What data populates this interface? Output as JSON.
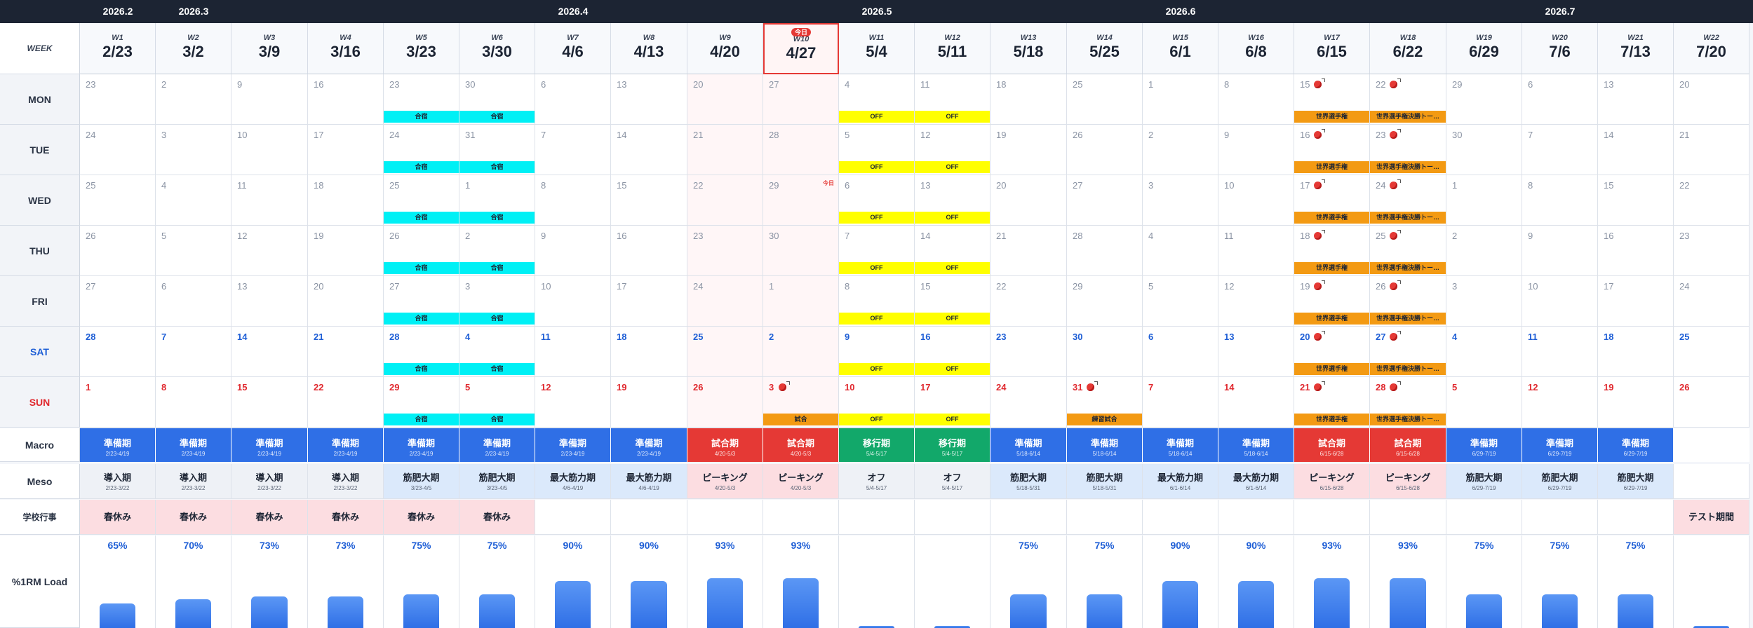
{
  "header": {
    "week_label": "WEEK"
  },
  "months": [
    {
      "label": "2026.2",
      "col": 0
    },
    {
      "label": "2026.3",
      "col": 1
    },
    {
      "label": "2026.4",
      "col": 6
    },
    {
      "label": "2026.5",
      "col": 10
    },
    {
      "label": "2026.6",
      "col": 14
    },
    {
      "label": "2026.7",
      "col": 19
    }
  ],
  "today_badge": "今日",
  "today_col": 9,
  "weeks": [
    {
      "w": "W1",
      "date": "2/23",
      "days": [
        "23",
        "24",
        "25",
        "26",
        "27",
        "28",
        "1"
      ]
    },
    {
      "w": "W2",
      "date": "3/2",
      "days": [
        "2",
        "3",
        "4",
        "5",
        "6",
        "7",
        "8"
      ]
    },
    {
      "w": "W3",
      "date": "3/9",
      "days": [
        "9",
        "10",
        "11",
        "12",
        "13",
        "14",
        "15"
      ]
    },
    {
      "w": "W4",
      "date": "3/16",
      "days": [
        "16",
        "17",
        "18",
        "19",
        "20",
        "21",
        "22"
      ]
    },
    {
      "w": "W5",
      "date": "3/23",
      "days": [
        "23",
        "24",
        "25",
        "26",
        "27",
        "28",
        "29"
      ]
    },
    {
      "w": "W6",
      "date": "3/30",
      "days": [
        "30",
        "31",
        "1",
        "2",
        "3",
        "4",
        "5"
      ]
    },
    {
      "w": "W7",
      "date": "4/6",
      "days": [
        "6",
        "7",
        "8",
        "9",
        "10",
        "11",
        "12"
      ]
    },
    {
      "w": "W8",
      "date": "4/13",
      "days": [
        "13",
        "14",
        "15",
        "16",
        "17",
        "18",
        "19"
      ]
    },
    {
      "w": "W9",
      "date": "4/20",
      "days": [
        "20",
        "21",
        "22",
        "23",
        "24",
        "25",
        "26"
      ]
    },
    {
      "w": "W10",
      "date": "4/27",
      "days": [
        "27",
        "28",
        "29",
        "30",
        "1",
        "2",
        "3"
      ]
    },
    {
      "w": "W11",
      "date": "5/4",
      "days": [
        "4",
        "5",
        "6",
        "7",
        "8",
        "9",
        "10"
      ]
    },
    {
      "w": "W12",
      "date": "5/11",
      "days": [
        "11",
        "12",
        "13",
        "14",
        "15",
        "16",
        "17"
      ]
    },
    {
      "w": "W13",
      "date": "5/18",
      "days": [
        "18",
        "19",
        "20",
        "21",
        "22",
        "23",
        "24"
      ]
    },
    {
      "w": "W14",
      "date": "5/25",
      "days": [
        "25",
        "26",
        "27",
        "28",
        "29",
        "30",
        "31"
      ]
    },
    {
      "w": "W15",
      "date": "6/1",
      "days": [
        "1",
        "2",
        "3",
        "4",
        "5",
        "6",
        "7"
      ]
    },
    {
      "w": "W16",
      "date": "6/8",
      "days": [
        "8",
        "9",
        "10",
        "11",
        "12",
        "13",
        "14"
      ]
    },
    {
      "w": "W17",
      "date": "6/15",
      "days": [
        "15",
        "16",
        "17",
        "18",
        "19",
        "20",
        "21"
      ]
    },
    {
      "w": "W18",
      "date": "6/22",
      "days": [
        "22",
        "23",
        "24",
        "25",
        "26",
        "27",
        "28"
      ]
    },
    {
      "w": "W19",
      "date": "6/29",
      "days": [
        "29",
        "30",
        "1",
        "2",
        "3",
        "4",
        "5"
      ]
    },
    {
      "w": "W20",
      "date": "7/6",
      "days": [
        "6",
        "7",
        "8",
        "9",
        "10",
        "11",
        "12"
      ]
    },
    {
      "w": "W21",
      "date": "7/13",
      "days": [
        "13",
        "14",
        "15",
        "16",
        "17",
        "18",
        "19"
      ]
    },
    {
      "w": "W22",
      "date": "7/20",
      "days": [
        "20",
        "21",
        "22",
        "23",
        "24",
        "25",
        "26"
      ]
    }
  ],
  "day_labels": [
    "MON",
    "TUE",
    "WED",
    "THU",
    "FRI",
    "SAT",
    "SUN"
  ],
  "row_labels": {
    "macro": "Macro",
    "meso": "Meso",
    "school": "学校行事",
    "load": "%1RM Load"
  },
  "pink_cols": [
    8,
    9
  ],
  "events": [
    {
      "col": 4,
      "rows": [
        0,
        1,
        2,
        3,
        4,
        5,
        6
      ],
      "label": "合宿",
      "color": "cyan"
    },
    {
      "col": 5,
      "rows": [
        0,
        1,
        2,
        3,
        4,
        5,
        6
      ],
      "label": "合宿",
      "color": "cyan"
    },
    {
      "col": 10,
      "rows": [
        0,
        1,
        2,
        3,
        4,
        5,
        6
      ],
      "label": "OFF",
      "color": "yellow"
    },
    {
      "col": 11,
      "rows": [
        0,
        1,
        2,
        3,
        4,
        5,
        6
      ],
      "label": "OFF",
      "color": "yellow"
    },
    {
      "col": 9,
      "rows": [
        6
      ],
      "label": "試合",
      "color": "orange"
    },
    {
      "col": 13,
      "rows": [
        6
      ],
      "label": "練習試合",
      "color": "orange"
    },
    {
      "col": 16,
      "rows": [
        0,
        1,
        2,
        3,
        4,
        5,
        6
      ],
      "label": "世界選手権",
      "color": "orange"
    },
    {
      "col": 17,
      "rows": [
        0,
        1,
        2,
        3,
        4,
        5,
        6
      ],
      "label": "世界選手権決勝トー…",
      "color": "orange"
    }
  ],
  "ball_cells": [
    {
      "col": 9,
      "row": 6
    },
    {
      "col": 13,
      "row": 6
    },
    {
      "col": 16,
      "row": 0
    },
    {
      "col": 16,
      "row": 1
    },
    {
      "col": 16,
      "row": 2
    },
    {
      "col": 16,
      "row": 3
    },
    {
      "col": 16,
      "row": 4
    },
    {
      "col": 16,
      "row": 5
    },
    {
      "col": 16,
      "row": 6
    },
    {
      "col": 17,
      "row": 0
    },
    {
      "col": 17,
      "row": 1
    },
    {
      "col": 17,
      "row": 2
    },
    {
      "col": 17,
      "row": 3
    },
    {
      "col": 17,
      "row": 4
    },
    {
      "col": 17,
      "row": 5
    },
    {
      "col": 17,
      "row": 6
    }
  ],
  "side_badge": {
    "col": 9,
    "row": 2,
    "text": "今日"
  },
  "macro": [
    {
      "name": "準備期",
      "range": "2/23-4/19",
      "color": "#2f6fe6"
    },
    {
      "name": "準備期",
      "range": "2/23-4/19",
      "color": "#2f6fe6"
    },
    {
      "name": "準備期",
      "range": "2/23-4/19",
      "color": "#2f6fe6"
    },
    {
      "name": "準備期",
      "range": "2/23-4/19",
      "color": "#2f6fe6"
    },
    {
      "name": "準備期",
      "range": "2/23-4/19",
      "color": "#2f6fe6"
    },
    {
      "name": "準備期",
      "range": "2/23-4/19",
      "color": "#2f6fe6"
    },
    {
      "name": "準備期",
      "range": "2/23-4/19",
      "color": "#2f6fe6"
    },
    {
      "name": "準備期",
      "range": "2/23-4/19",
      "color": "#2f6fe6"
    },
    {
      "name": "試合期",
      "range": "4/20-5/3",
      "color": "#e53935"
    },
    {
      "name": "試合期",
      "range": "4/20-5/3",
      "color": "#e53935"
    },
    {
      "name": "移行期",
      "range": "5/4-5/17",
      "color": "#12a86a"
    },
    {
      "name": "移行期",
      "range": "5/4-5/17",
      "color": "#12a86a"
    },
    {
      "name": "準備期",
      "range": "5/18-6/14",
      "color": "#2f6fe6"
    },
    {
      "name": "準備期",
      "range": "5/18-6/14",
      "color": "#2f6fe6"
    },
    {
      "name": "準備期",
      "range": "5/18-6/14",
      "color": "#2f6fe6"
    },
    {
      "name": "準備期",
      "range": "5/18-6/14",
      "color": "#2f6fe6"
    },
    {
      "name": "試合期",
      "range": "6/15-6/28",
      "color": "#e53935"
    },
    {
      "name": "試合期",
      "range": "6/15-6/28",
      "color": "#e53935"
    },
    {
      "name": "準備期",
      "range": "6/29-7/19",
      "color": "#2f6fe6"
    },
    {
      "name": "準備期",
      "range": "6/29-7/19",
      "color": "#2f6fe6"
    },
    {
      "name": "準備期",
      "range": "6/29-7/19",
      "color": "#2f6fe6"
    },
    {
      "name": "",
      "range": "",
      "color": "#ffffff"
    }
  ],
  "meso": [
    {
      "name": "導入期",
      "range": "2/23-3/22",
      "bg": "#eef1f6"
    },
    {
      "name": "導入期",
      "range": "2/23-3/22",
      "bg": "#eef1f6"
    },
    {
      "name": "導入期",
      "range": "2/23-3/22",
      "bg": "#eef1f6"
    },
    {
      "name": "導入期",
      "range": "2/23-3/22",
      "bg": "#eef1f6"
    },
    {
      "name": "筋肥大期",
      "range": "3/23-4/5",
      "bg": "#dbe9fb"
    },
    {
      "name": "筋肥大期",
      "range": "3/23-4/5",
      "bg": "#dbe9fb"
    },
    {
      "name": "最大筋力期",
      "range": "4/6-4/19",
      "bg": "#dbe9fb"
    },
    {
      "name": "最大筋力期",
      "range": "4/6-4/19",
      "bg": "#dbe9fb"
    },
    {
      "name": "ピーキング",
      "range": "4/20-5/3",
      "bg": "#fcdde1"
    },
    {
      "name": "ピーキング",
      "range": "4/20-5/3",
      "bg": "#fcdde1"
    },
    {
      "name": "オフ",
      "range": "5/4-5/17",
      "bg": "#eef1f6"
    },
    {
      "name": "オフ",
      "range": "5/4-5/17",
      "bg": "#eef1f6"
    },
    {
      "name": "筋肥大期",
      "range": "5/18-5/31",
      "bg": "#dbe9fb"
    },
    {
      "name": "筋肥大期",
      "range": "5/18-5/31",
      "bg": "#dbe9fb"
    },
    {
      "name": "最大筋力期",
      "range": "6/1-6/14",
      "bg": "#dbe9fb"
    },
    {
      "name": "最大筋力期",
      "range": "6/1-6/14",
      "bg": "#dbe9fb"
    },
    {
      "name": "ピーキング",
      "range": "6/15-6/28",
      "bg": "#fcdde1"
    },
    {
      "name": "ピーキング",
      "range": "6/15-6/28",
      "bg": "#fcdde1"
    },
    {
      "name": "筋肥大期",
      "range": "6/29-7/19",
      "bg": "#dbe9fb"
    },
    {
      "name": "筋肥大期",
      "range": "6/29-7/19",
      "bg": "#dbe9fb"
    },
    {
      "name": "筋肥大期",
      "range": "6/29-7/19",
      "bg": "#dbe9fb"
    },
    {
      "name": "",
      "range": "",
      "bg": "#ffffff"
    }
  ],
  "school": [
    "春休み",
    "春休み",
    "春休み",
    "春休み",
    "春休み",
    "春休み",
    "",
    "",
    "",
    "",
    "",
    "",
    "",
    "",
    "",
    "",
    "",
    "",
    "",
    "",
    "",
    "テスト期間"
  ],
  "load": [
    {
      "pct": "65%",
      "level": 0.65
    },
    {
      "pct": "70%",
      "level": 0.7
    },
    {
      "pct": "73%",
      "level": 0.73
    },
    {
      "pct": "73%",
      "level": 0.73
    },
    {
      "pct": "75%",
      "level": 0.75
    },
    {
      "pct": "75%",
      "level": 0.75
    },
    {
      "pct": "90%",
      "level": 0.9
    },
    {
      "pct": "90%",
      "level": 0.9
    },
    {
      "pct": "93%",
      "level": 0.93
    },
    {
      "pct": "93%",
      "level": 0.93
    },
    {
      "pct": "",
      "level": 0.02
    },
    {
      "pct": "",
      "level": 0.02
    },
    {
      "pct": "75%",
      "level": 0.75
    },
    {
      "pct": "75%",
      "level": 0.75
    },
    {
      "pct": "90%",
      "level": 0.9
    },
    {
      "pct": "90%",
      "level": 0.9
    },
    {
      "pct": "93%",
      "level": 0.93
    },
    {
      "pct": "93%",
      "level": 0.93
    },
    {
      "pct": "75%",
      "level": 0.75
    },
    {
      "pct": "75%",
      "level": 0.75
    },
    {
      "pct": "75%",
      "level": 0.75
    },
    {
      "pct": "",
      "level": 0.02
    }
  ]
}
